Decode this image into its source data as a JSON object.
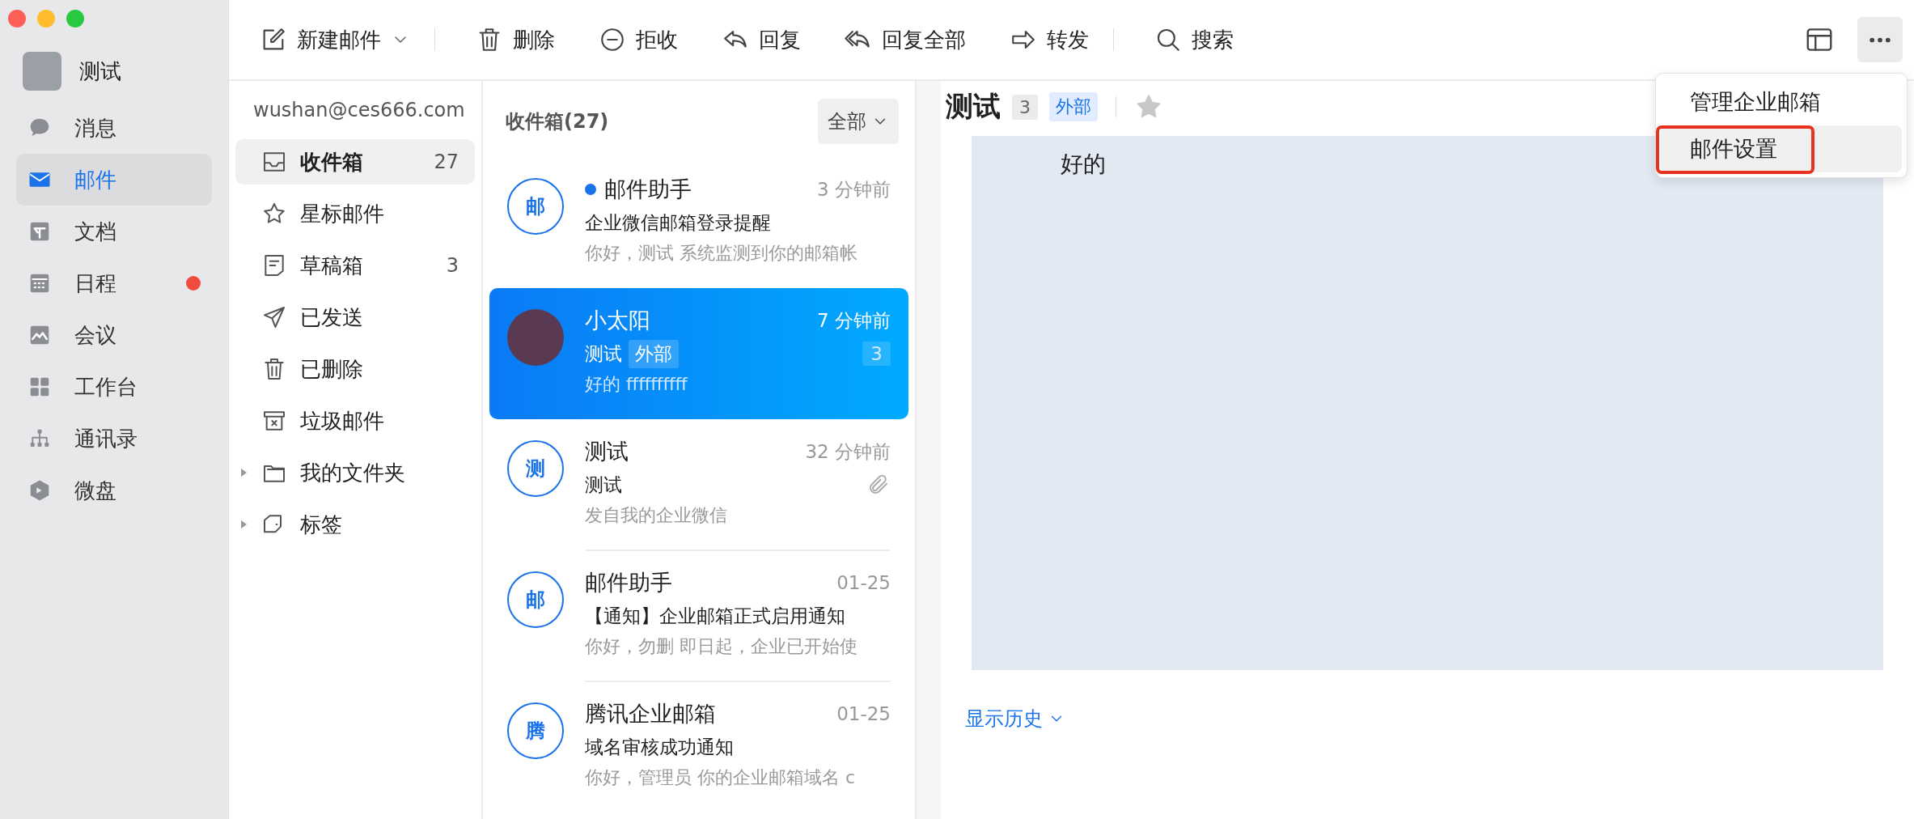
{
  "profile": {
    "name": "测试"
  },
  "nav": [
    {
      "label": "消息",
      "selected": false,
      "notification": false
    },
    {
      "label": "邮件",
      "selected": true,
      "notification": false
    },
    {
      "label": "文档",
      "selected": false,
      "notification": false
    },
    {
      "label": "日程",
      "selected": false,
      "notification": true
    },
    {
      "label": "会议",
      "selected": false,
      "notification": false
    },
    {
      "label": "工作台",
      "selected": false,
      "notification": false
    },
    {
      "label": "通讯录",
      "selected": false,
      "notification": false
    },
    {
      "label": "微盘",
      "selected": false,
      "notification": false
    }
  ],
  "toolbar": {
    "actions": [
      {
        "label": "新建邮件",
        "dropdown": true
      },
      {
        "label": "删除",
        "dropdown": false
      },
      {
        "label": "拒收",
        "dropdown": false
      },
      {
        "label": "回复",
        "dropdown": false
      },
      {
        "label": "回复全部",
        "dropdown": false
      },
      {
        "label": "转发",
        "dropdown": false
      },
      {
        "label": "搜索",
        "dropdown": false
      }
    ]
  },
  "folders": {
    "account": "wushan@ces666.com",
    "items": [
      {
        "kind": "folder",
        "label": "收件箱",
        "count": "27",
        "selected": true
      },
      {
        "kind": "folder",
        "label": "星标邮件",
        "selected": false
      },
      {
        "kind": "folder",
        "label": "草稿箱",
        "count": "3",
        "selected": false
      },
      {
        "kind": "folder",
        "label": "已发送",
        "selected": false
      },
      {
        "kind": "folder",
        "label": "已删除",
        "selected": false
      },
      {
        "kind": "folder",
        "label": "垃圾邮件",
        "selected": false
      },
      {
        "kind": "group",
        "label": "我的文件夹",
        "selected": false,
        "expanded": false
      },
      {
        "kind": "group",
        "label": "标签",
        "selected": false,
        "expanded": false
      }
    ]
  },
  "message_list": {
    "title": "收件箱(27)",
    "filter": "全部",
    "messages": [
      {
        "avatar": {
          "kind": "letter",
          "text": "邮"
        },
        "sender": "邮件助手",
        "unread": true,
        "time": "3 分钟前",
        "subject": "企业微信邮箱登录提醒",
        "preview": "你好，测试 系统监测到你的邮箱帐",
        "selected": false,
        "attachment": false
      },
      {
        "avatar": {
          "kind": "photo"
        },
        "sender": "小太阳",
        "unread": false,
        "time": "7 分钟前",
        "subject": "测试",
        "tag": "外部",
        "count": "3",
        "preview": "好的 ffffffffff",
        "selected": true,
        "attachment": false
      },
      {
        "avatar": {
          "kind": "letter",
          "text": "测"
        },
        "sender": "测试",
        "unread": false,
        "time": "32 分钟前",
        "subject": "测试",
        "preview": "发自我的企业微信",
        "selected": false,
        "attachment": true
      },
      {
        "avatar": {
          "kind": "letter",
          "text": "邮"
        },
        "sender": "邮件助手",
        "unread": false,
        "time": "01-25",
        "subject": "【通知】企业邮箱正式启用通知",
        "preview": "你好，勿删 即日起，企业已开始使",
        "selected": false,
        "attachment": false
      },
      {
        "avatar": {
          "kind": "letter",
          "text": "腾"
        },
        "sender": "腾讯企业邮箱",
        "unread": false,
        "time": "01-25",
        "subject": "域名审核成功通知",
        "preview": "你好，管理员 你的企业邮箱域名 c",
        "selected": false,
        "attachment": false
      }
    ]
  },
  "reading_pane": {
    "subject": "测试",
    "count": "3",
    "tag": "外部",
    "starred": false,
    "body": "好的",
    "history_link": "显示历史"
  },
  "more_menu": {
    "items": [
      {
        "label": "管理企业邮箱",
        "selected": false,
        "highlighted": false
      },
      {
        "label": "邮件设置",
        "selected": true,
        "highlighted": true
      }
    ]
  }
}
